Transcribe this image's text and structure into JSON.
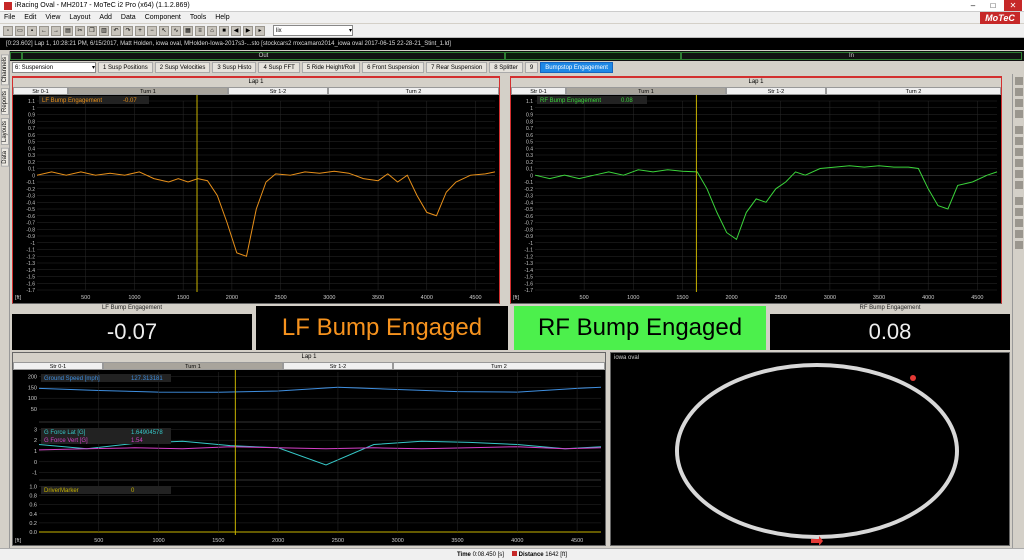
{
  "window": {
    "title": "iRacing Oval - MH2017 - MoTeC i2 Pro (x64) (1.1.2.869)",
    "brand": "MoTeC"
  },
  "menu": [
    "File",
    "Edit",
    "View",
    "Layout",
    "Add",
    "Data",
    "Component",
    "Tools",
    "Help"
  ],
  "toolbar": {
    "select_value": "lix"
  },
  "infobar": {
    "text": "[0:23.602] Lap 1, 10:28:21 PM, 6/15/2017, Matt Holden, iowa oval, MHolden-Iowa-2017s3-...sto [stockcars2 mxcamaro2014_iowa oval 2017-06-15 22-28-21_Stint_1.ld]"
  },
  "outin": {
    "out": "Out",
    "in": "In"
  },
  "tabs": {
    "selector": "6: Suspension",
    "items": [
      "1 Susp Positions",
      "2 Susp Velocities",
      "3 Susp Histo",
      "4 Susp FFT",
      "5 Ride Height/Roll",
      "6 Front Suspension",
      "7 Rear Suspension",
      "8 Splitter",
      "9"
    ],
    "active": "Bumpstop Engagement"
  },
  "sidebar_tabs": [
    "Channels",
    "Reports",
    "Layouts",
    "Data"
  ],
  "lap_label": "Lap 1",
  "turns": {
    "s01": "Str 0-1",
    "t1": "Turn 1",
    "s12": "Str 1-2",
    "t2": "Turn 2"
  },
  "x_axis": {
    "unit_label": "[ft]",
    "ticks": [
      "500",
      "1000",
      "1500",
      "2000",
      "2500",
      "3000",
      "3500",
      "4000",
      "4500"
    ]
  },
  "lf_graph": {
    "legend_name": "LF Bump Engagement",
    "legend_value": "-0.07",
    "color": "#e8901a"
  },
  "rf_graph": {
    "legend_name": "RF Bump Engagement",
    "legend_value": "0.08",
    "color": "#3bd43b"
  },
  "y_ticks_bump": [
    "1.1",
    "1",
    "0.9",
    "0.8",
    "0.7",
    "0.6",
    "0.5",
    "0.4",
    "0.3",
    "0.2",
    "0.1",
    "0",
    "-0.1",
    "-0.2",
    "-0.3",
    "-0.4",
    "-0.5",
    "-0.6",
    "-0.7",
    "-0.8",
    "-0.9",
    "-1",
    "-1.1",
    "-1.2",
    "-1.3",
    "-1.4",
    "-1.5",
    "-1.6",
    "-1.7"
  ],
  "displays": {
    "lf_caption": "LF Bump Engagement",
    "lf_value": "-0.07",
    "lf_banner": "LF Bump Engaged",
    "lf_banner_bg": "#f7931e",
    "rf_banner": "RF Bump Engaged",
    "rf_banner_bg": "#4cf04c",
    "rf_caption": "RF Bump Engagement",
    "rf_value": "0.08"
  },
  "bottom_graph": {
    "speed_name": "Ground Speed [mph]",
    "speed_value": "127.313181",
    "speed_color": "#3f8fe0",
    "lat_name": "G Force Lat [G]",
    "lat_value": "1.64904578",
    "lat_color": "#36c8c8",
    "vert_name": "G Force Vert [G]",
    "vert_value": "1.54",
    "vert_color": "#d640c8",
    "marker_name": "DriverMarker",
    "marker_value": "0",
    "speed_ticks": [
      "200",
      "150",
      "100",
      "50"
    ],
    "g_ticks": [
      "3",
      "2",
      "1",
      "0",
      "-1"
    ],
    "marker_ticks": [
      "1.0",
      "0.8",
      "0.6",
      "0.4",
      "0.2",
      "0.0"
    ],
    "x_ticks": [
      "500",
      "1000",
      "1500",
      "2000",
      "2500",
      "3000",
      "3500",
      "4000",
      "4500"
    ]
  },
  "track": {
    "name": "iowa oval"
  },
  "status": {
    "time_label": "Time",
    "time_value": "0:08.450 [s]",
    "dist_label": "Distance",
    "dist_value": "1642 [ft]"
  },
  "chart_data": [
    {
      "type": "line",
      "title": "LF Bump Engagement",
      "xlabel": "[ft]",
      "ylabel": "",
      "xlim": [
        0,
        4700
      ],
      "ylim": [
        -1.7,
        1.1
      ],
      "cursor_x": 1642,
      "series": [
        {
          "name": "LF Bump Engagement",
          "x": [
            0,
            150,
            300,
            450,
            600,
            750,
            900,
            1050,
            1200,
            1350,
            1450,
            1550,
            1650,
            1750,
            1850,
            1950,
            2050,
            2150,
            2250,
            2350,
            2450,
            2600,
            2750,
            2900,
            3050,
            3200,
            3350,
            3500,
            3600,
            3700,
            3800,
            3900,
            4000,
            4100,
            4200,
            4300,
            4450,
            4600,
            4700
          ],
          "values": [
            0.0,
            0.05,
            0.0,
            0.05,
            0.0,
            0.03,
            0.0,
            0.05,
            -0.05,
            -0.1,
            -0.05,
            -0.1,
            -0.05,
            -0.08,
            -0.3,
            -0.7,
            -1.15,
            -1.2,
            -0.5,
            -0.1,
            0.02,
            0.0,
            0.05,
            0.03,
            0.06,
            0.03,
            -0.05,
            -0.08,
            0.02,
            -0.1,
            0.0,
            -0.3,
            -0.55,
            -0.6,
            -0.25,
            -0.1,
            0.0,
            0.02,
            0.05
          ]
        }
      ]
    },
    {
      "type": "line",
      "title": "RF Bump Engagement",
      "xlabel": "[ft]",
      "ylabel": "",
      "xlim": [
        0,
        4700
      ],
      "ylim": [
        -1.7,
        1.1
      ],
      "cursor_x": 1642,
      "series": [
        {
          "name": "RF Bump Engagement",
          "x": [
            0,
            150,
            300,
            450,
            600,
            750,
            900,
            1050,
            1200,
            1350,
            1500,
            1650,
            1750,
            1850,
            1950,
            2050,
            2150,
            2250,
            2350,
            2450,
            2550,
            2650,
            2750,
            2900,
            3050,
            3200,
            3350,
            3500,
            3650,
            3800,
            3900,
            4000,
            4100,
            4200,
            4300,
            4450,
            4600,
            4700
          ],
          "values": [
            0.0,
            -0.05,
            0.0,
            -0.05,
            0.0,
            0.05,
            0.0,
            0.08,
            0.05,
            0.08,
            0.06,
            0.05,
            -0.2,
            -0.55,
            -0.85,
            -0.95,
            -0.55,
            -0.35,
            -0.4,
            -0.2,
            -0.1,
            0.05,
            0.0,
            0.1,
            0.12,
            0.14,
            0.12,
            0.14,
            0.12,
            0.12,
            0.1,
            -0.2,
            -0.45,
            -0.5,
            -0.15,
            -0.1,
            0.0,
            0.05
          ]
        }
      ]
    },
    {
      "type": "line",
      "title": "",
      "xlabel": "[ft]",
      "ylabel": "",
      "xlim": [
        0,
        4700
      ],
      "cursor_x": 1642,
      "series": [
        {
          "name": "Ground Speed [mph]",
          "x": [
            0,
            500,
            1000,
            1500,
            2000,
            2500,
            3000,
            3500,
            4000,
            4500,
            4700
          ],
          "values": [
            145,
            135,
            128,
            127,
            133,
            150,
            140,
            130,
            128,
            145,
            150
          ],
          "ylim": [
            0,
            220
          ]
        },
        {
          "name": "G Force Lat [G]",
          "x": [
            0,
            400,
            800,
            1200,
            1600,
            2000,
            2400,
            2800,
            3200,
            3600,
            4000,
            4400,
            4700
          ],
          "values": [
            1.6,
            1.2,
            1.7,
            1.9,
            1.5,
            1.3,
            -0.3,
            1.6,
            1.9,
            1.8,
            1.6,
            1.2,
            1.4
          ],
          "ylim": [
            -1.5,
            3.5
          ]
        },
        {
          "name": "G Force Vert [G]",
          "x": [
            0,
            400,
            800,
            1200,
            1600,
            2000,
            2400,
            2800,
            3200,
            3600,
            4000,
            4400,
            4700
          ],
          "values": [
            1.1,
            1.2,
            1.3,
            1.2,
            1.4,
            1.3,
            1.2,
            1.3,
            1.2,
            1.3,
            1.4,
            1.2,
            1.3
          ],
          "ylim": [
            -1.5,
            3.5
          ]
        },
        {
          "name": "DriverMarker",
          "x": [
            0,
            4700
          ],
          "values": [
            0,
            0
          ],
          "ylim": [
            0,
            1.1
          ]
        }
      ]
    }
  ]
}
